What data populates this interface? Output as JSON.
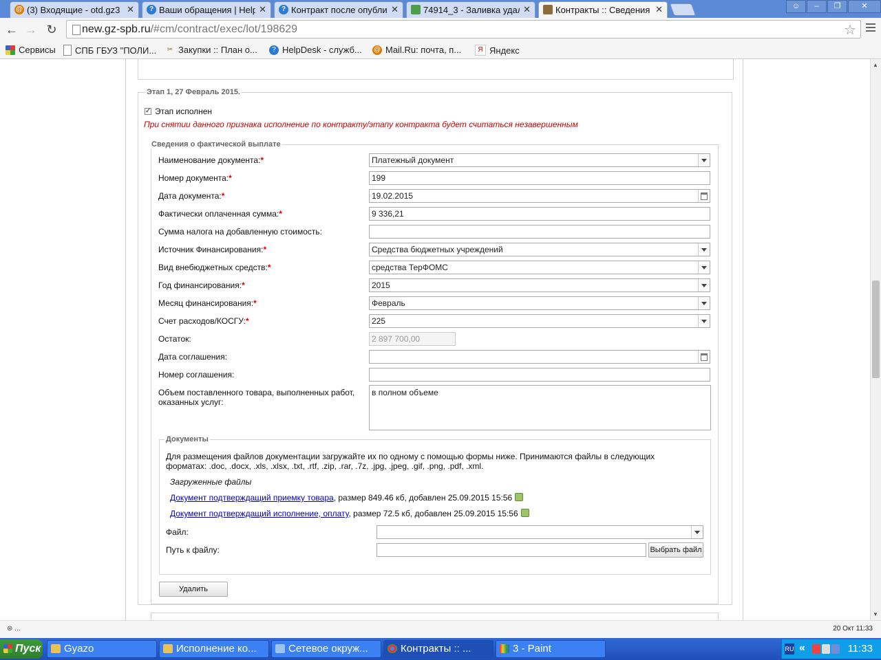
{
  "browser": {
    "tabs": [
      {
        "title": "(3) Входящие - otd.gz3",
        "icon_color": "#e07b00",
        "active": false
      },
      {
        "title": "Ваши обращения | Help",
        "icon_color": "#2a7bd4",
        "active": false
      },
      {
        "title": "Контракт после опубли",
        "icon_color": "#2a7bd4",
        "active": false
      },
      {
        "title": "74914_3 - Заливка удал",
        "icon_color": "#4aa04a",
        "active": false
      },
      {
        "title": "Контракты :: Сведения",
        "icon_color": "#8a6d3b",
        "active": true
      }
    ],
    "url_host": "new.gz-spb.ru",
    "url_rest": "/#cm/contract/exec/lot/198629",
    "bookmarks": [
      {
        "label": "Сервисы",
        "icon": "apps-icon"
      },
      {
        "label": "СПБ ГБУЗ \"ПОЛИ...",
        "icon": "page-icon"
      },
      {
        "label": "Закупки :: План о...",
        "icon": "tools-icon"
      },
      {
        "label": "HelpDesk - служб...",
        "icon": "help-icon"
      },
      {
        "label": "Mail.Ru: почта, п...",
        "icon": "mail-icon"
      },
      {
        "label": "Яндекс",
        "icon": "yandex-icon"
      }
    ]
  },
  "stage": {
    "legend": "Этап 1, 27 Февраль 2015.",
    "completed_label": "Этап исполнен",
    "completed_checked": true,
    "warning": "При снятии данного признака исполнение по контракту/этапу контракта будет считаться незавершенным"
  },
  "payment": {
    "legend": "Сведения о фактической выплате",
    "fields": {
      "doc_name": {
        "label": "Наименование документа:",
        "value": "Платежный документ"
      },
      "doc_number": {
        "label": "Номер документа:",
        "value": "199"
      },
      "doc_date": {
        "label": "Дата документа:",
        "value": "19.02.2015"
      },
      "paid_sum": {
        "label": "Фактически оплаченная сумма:",
        "value": "9 336,21"
      },
      "vat_sum": {
        "label": "Сумма налога на добавленную стоимость:",
        "value": ""
      },
      "fin_source": {
        "label": "Источник Финансирования:",
        "value": "Средства бюджетных учреждений"
      },
      "offbudget_type": {
        "label": "Вид внебюджетных средств:",
        "value": "средства ТерФОМС"
      },
      "fin_year": {
        "label": "Год финансирования:",
        "value": "2015"
      },
      "fin_month": {
        "label": "Месяц финансирования:",
        "value": "Февраль"
      },
      "expense_account": {
        "label": "Счет расходов/КОСГУ:",
        "value": "225"
      },
      "balance": {
        "label": "Остаток:",
        "value": "2 897 700,00"
      },
      "agreement_date": {
        "label": "Дата соглашения:",
        "value": ""
      },
      "agreement_number": {
        "label": "Номер соглашения:",
        "value": ""
      },
      "volume_line1": "Объем поставленного товара, выполненных работ,",
      "volume_line2": "оказанных услуг:",
      "volume_value": "в полном объеме"
    }
  },
  "documents": {
    "legend": "Документы",
    "info_line1": "Для размещения файлов документации загружайте их по одному с помощью формы ниже. Принимаются файлы в следующих",
    "info_line2": "форматах: .doc, .docx, .xls, .xlsx, .txt, .rtf, .zip, .rar, .7z, .jpg, .jpeg, .gif, .png, .pdf, .xml.",
    "uploaded_title": "Загруженные файлы",
    "files": [
      {
        "name": "Документ подтверждащий приемку товара",
        "meta": ", размер 849.46 кб, добавлен 25.09.2015 15:56"
      },
      {
        "name": "Документ подтверждащий исполнение, оплату",
        "meta": ", размер 72.5 кб, добавлен 25.09.2015 15:56"
      }
    ],
    "file_label": "Файл:",
    "path_label": "Путь к файлу:",
    "browse_button": "Выбрать файл"
  },
  "delete_button": "Удалить",
  "status": {
    "left": "...",
    "right": "20 Окт 11:33"
  },
  "taskbar": {
    "start": "Пуск",
    "items": [
      {
        "label": "Gyazo",
        "active": false
      },
      {
        "label": "Исполнение ко...",
        "active": false
      },
      {
        "label": "Сетевое окруж...",
        "active": false
      },
      {
        "label": "Контракты :: ...",
        "active": true
      },
      {
        "label": "3 - Paint",
        "active": false
      }
    ],
    "lang": "RU",
    "time": "11:33"
  },
  "colors": {
    "required": "#dd0000",
    "warning": "#cc0000",
    "link": "#0000cc",
    "taskbar": "#2458c7"
  }
}
